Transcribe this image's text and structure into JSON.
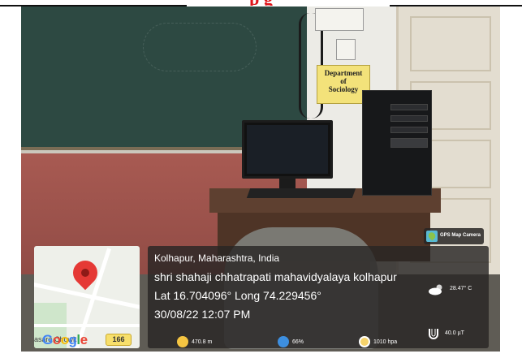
{
  "header": {
    "heading_fragment": "p    g"
  },
  "scene": {
    "sign": {
      "line1": "Department",
      "line2": "of",
      "line3": "Sociology"
    }
  },
  "map": {
    "logo": "Google",
    "place_label": "asara Chowk",
    "road_number": "166"
  },
  "stamp": {
    "location": "Kolhapur, Maharashtra, India",
    "place": "shri shahaji chhatrapati mahavidyalaya kolhapur",
    "coords": "Lat 16.704096° Long 74.229456°",
    "datetime": "30/08/22 12:07 PM",
    "app_name": "GPS Map Camera",
    "temperature": "28.47° C",
    "altitude": "470.8 m",
    "humidity": "66%",
    "pressure": "1010 hpa",
    "magnetic": "40.0 µT"
  },
  "colors": {
    "heading": "#e0141a",
    "panel": "#282624",
    "pin": "#e53935"
  },
  "icons": [
    "map-pin-icon",
    "cloud-sun-icon",
    "altitude-icon",
    "humidity-icon",
    "pressure-icon",
    "magnet-icon",
    "gps-camera-icon"
  ]
}
